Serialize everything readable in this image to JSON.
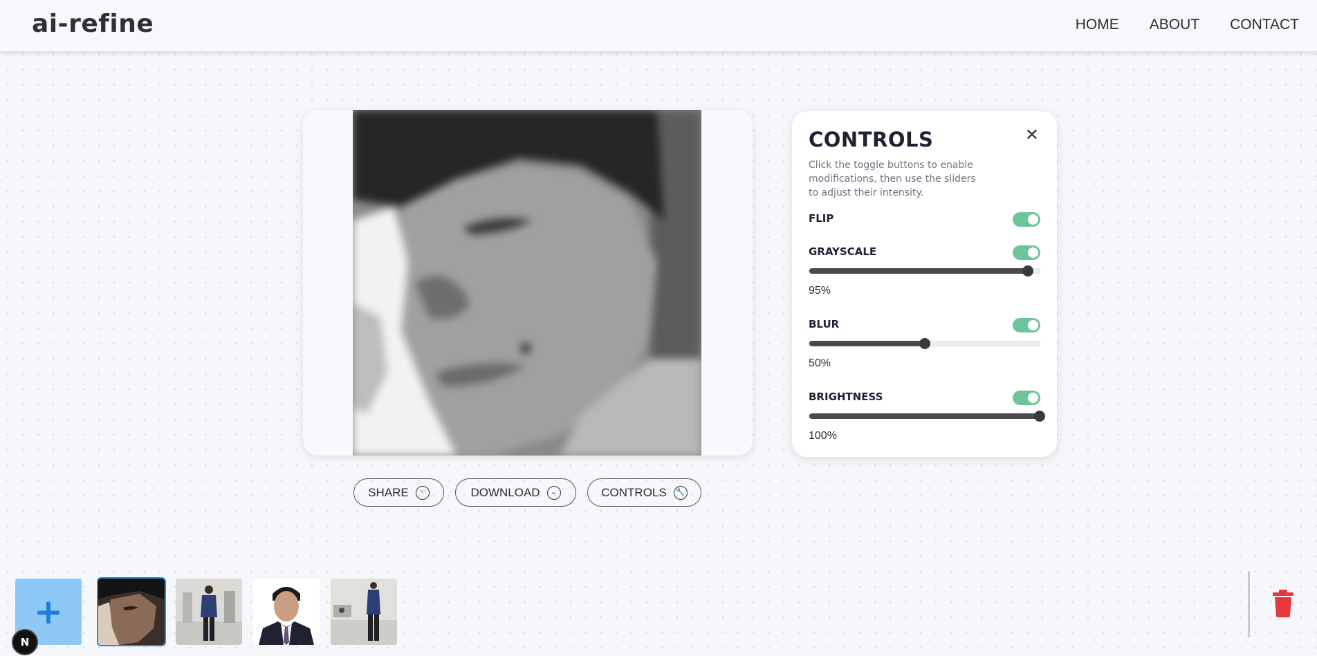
{
  "header": {
    "logo": "ai-refine",
    "nav": [
      {
        "label": "HOME"
      },
      {
        "label": "ABOUT"
      },
      {
        "label": "CONTACT"
      }
    ]
  },
  "actions": {
    "share_label": "SHARE",
    "download_label": "DOWNLOAD",
    "controls_label": "CONTROLS"
  },
  "controls": {
    "title": "CONTROLS",
    "close_icon": "close-icon",
    "description": "Click the toggle buttons to enable modifications, then use the sliders to adjust their intensity.",
    "items": [
      {
        "label": "FLIP",
        "enabled": true
      },
      {
        "label": "GRAYSCALE",
        "enabled": true,
        "value": 0.95,
        "value_text": "95%"
      },
      {
        "label": "BLUR",
        "enabled": true,
        "value": 0.5,
        "value_text": "50%"
      },
      {
        "label": "BRIGHTNESS",
        "enabled": true,
        "value": 1.0,
        "value_text": "100%"
      }
    ],
    "toggle_color": "#6ec49a"
  },
  "gallery": {
    "add_label": "+",
    "selected_index": 0,
    "thumbnails": [
      {
        "subject": "face-closeup-photo"
      },
      {
        "subject": "man-in-suit-standing-photo"
      },
      {
        "subject": "portrait-in-suit-photo"
      },
      {
        "subject": "man-in-suit-side-photo"
      }
    ],
    "delete_icon": "trash-icon",
    "delete_color": "#e5383b"
  },
  "badge": {
    "label": "N"
  }
}
